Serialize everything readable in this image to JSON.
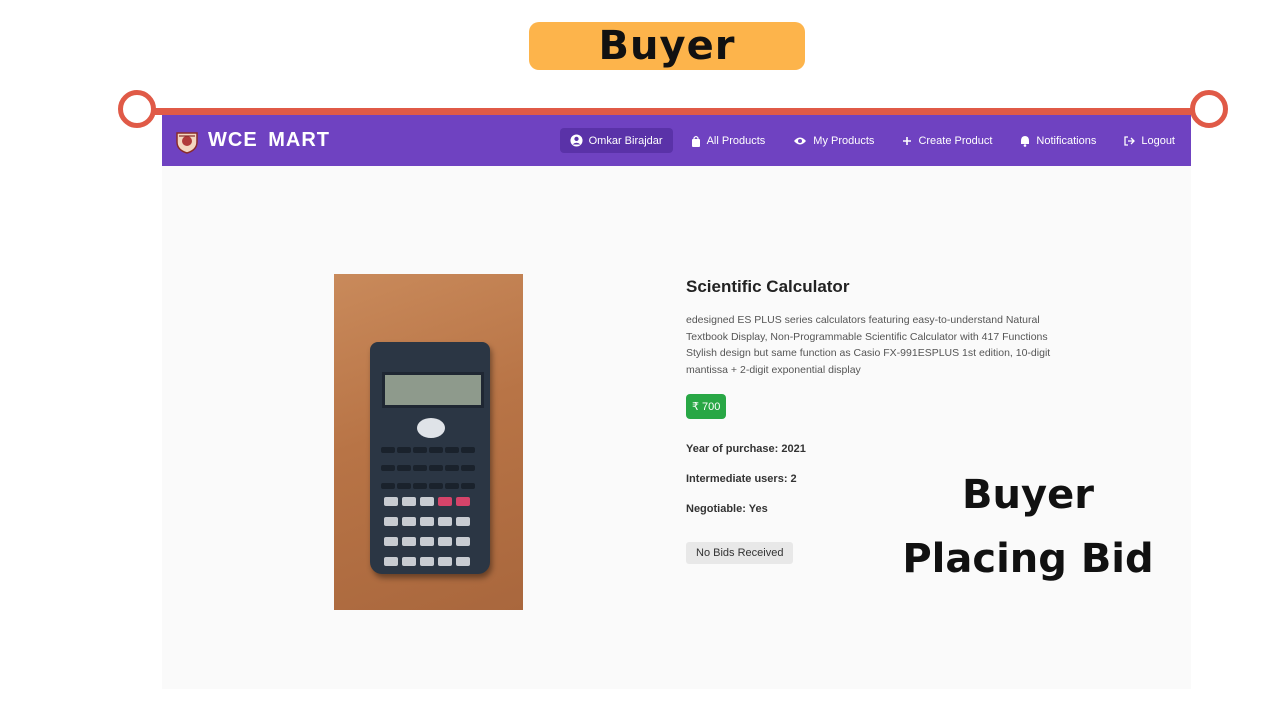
{
  "banner": {
    "label": "Buyer"
  },
  "navbar": {
    "brand": "WCE MART",
    "items": [
      {
        "label": "Omkar Birajdar",
        "icon": "user-circle-icon"
      },
      {
        "label": "All Products",
        "icon": "shopping-bag-icon"
      },
      {
        "label": "My Products",
        "icon": "eye-icon"
      },
      {
        "label": "Create Product",
        "icon": "plus-icon"
      },
      {
        "label": "Notifications",
        "icon": "bell-icon"
      },
      {
        "label": "Logout",
        "icon": "logout-icon"
      }
    ]
  },
  "product": {
    "title": "Scientific Calculator",
    "description_lines": [
      "edesigned ES PLUS series calculators featuring easy-to-understand Natural",
      "Textbook Display, Non-Programmable Scientific Calculator with 417 Functions",
      "Stylish design but same function as Casio FX-991ESPLUS 1st edition, 10-digit",
      "mantissa + 2-digit exponential display"
    ],
    "price": "₹ 700",
    "year_of_purchase": "Year of purchase: 2021",
    "intermediate_users": "Intermediate users: 2",
    "negotiable": "Negotiable: Yes",
    "bids_status": "No Bids Received"
  },
  "overlay": {
    "line1": "Buyer",
    "line2": "Placing Bid"
  },
  "colors": {
    "navbar": "#6f42c1",
    "price_badge": "#28a745",
    "banner": "#fdb44b",
    "accent_line": "#e05a47"
  }
}
